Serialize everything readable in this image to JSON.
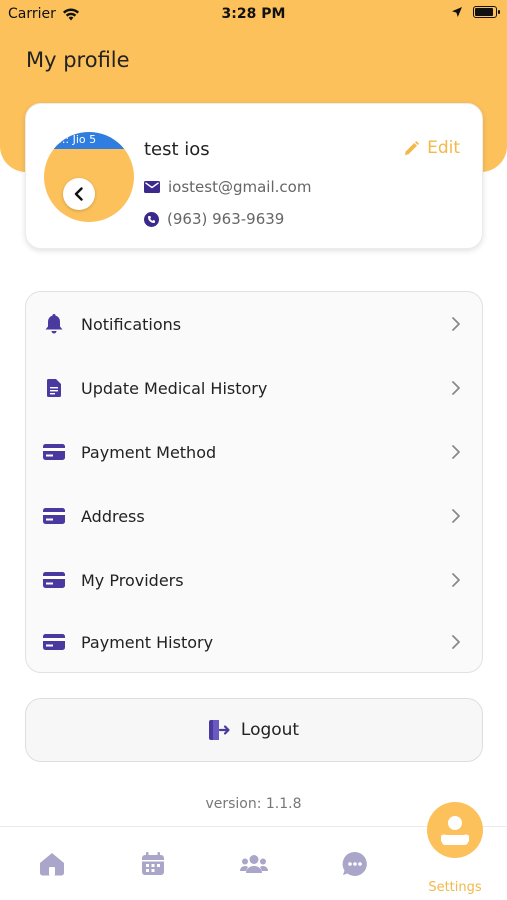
{
  "status_bar": {
    "carrier": "Carrier",
    "time": "3:28 PM"
  },
  "header": {
    "title": "My profile"
  },
  "profile": {
    "avatar_overlay_text": "::: Jio 5",
    "name": "test ios",
    "edit_label": "Edit",
    "email": "iostest@gmail.com",
    "phone": "(963) 963-9639"
  },
  "menu": {
    "items": [
      {
        "label": "Notifications",
        "icon": "bell-icon"
      },
      {
        "label": "Update Medical History",
        "icon": "document-icon"
      },
      {
        "label": "Payment Method",
        "icon": "card-icon"
      },
      {
        "label": "Address",
        "icon": "card-icon"
      },
      {
        "label": "My Providers",
        "icon": "card-icon"
      },
      {
        "label": "Payment History",
        "icon": "card-icon"
      }
    ]
  },
  "logout": {
    "label": "Logout"
  },
  "version": "version: 1.1.8",
  "bottom_nav": {
    "items": [
      {
        "icon": "home-icon"
      },
      {
        "icon": "calendar-icon"
      },
      {
        "icon": "users-icon"
      },
      {
        "icon": "chat-icon"
      }
    ],
    "active_label": "Settings"
  },
  "colors": {
    "accent": "#fcc15b",
    "accent_text": "#f2b84a",
    "icon_purple": "#4a3aa0",
    "nav_inactive": "#a9a6c9"
  }
}
